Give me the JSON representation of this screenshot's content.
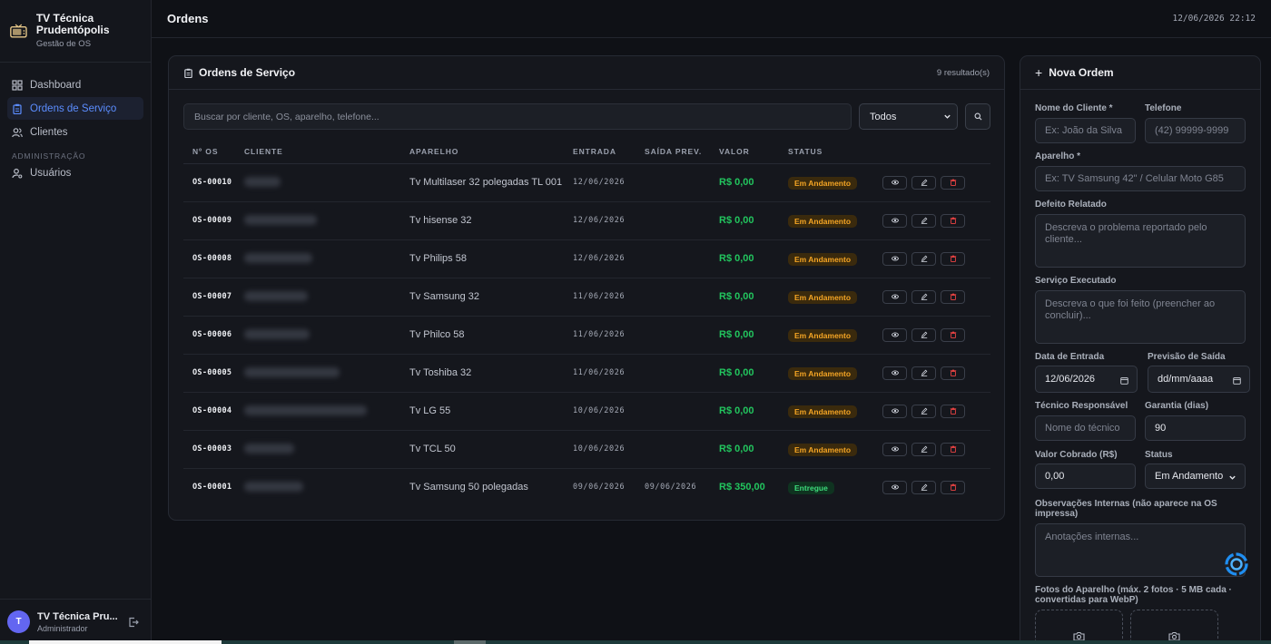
{
  "app": {
    "name": "TV Técnica Prudentópolis",
    "subtitle": "Gestão de OS"
  },
  "sidebar": {
    "items": [
      {
        "label": "Dashboard",
        "icon": "dashboard-icon",
        "active": false
      },
      {
        "label": "Ordens de Serviço",
        "icon": "clipboard-icon",
        "active": true
      },
      {
        "label": "Clientes",
        "icon": "users-icon",
        "active": false
      }
    ],
    "section_label": "ADMINISTRAÇÃO",
    "admin_items": [
      {
        "label": "Usuários",
        "icon": "user-cog-icon"
      }
    ]
  },
  "user": {
    "initial": "T",
    "name": "TV Técnica Pru...",
    "role": "Administrador"
  },
  "header": {
    "title": "Ordens",
    "datetime": "12/06/2026 22:12"
  },
  "orders_panel": {
    "title": "Ordens de Serviço",
    "result_count": "9 resultado(s)",
    "search_placeholder": "Buscar por cliente, OS, aparelho, telefone...",
    "filter_value": "Todos",
    "columns": [
      "Nº OS",
      "CLIENTE",
      "APARELHO",
      "ENTRADA",
      "SAÍDA PREV.",
      "VALOR",
      "STATUS"
    ],
    "rows": [
      {
        "os": "OS-00010",
        "device": "Tv Multilaser 32 polegadas TL 001",
        "in": "12/06/2026",
        "out": "",
        "value": "R$ 0,00",
        "status": "Em Andamento"
      },
      {
        "os": "OS-00009",
        "device": "Tv hisense 32",
        "in": "12/06/2026",
        "out": "",
        "value": "R$ 0,00",
        "status": "Em Andamento"
      },
      {
        "os": "OS-00008",
        "device": "Tv Philips 58",
        "in": "12/06/2026",
        "out": "",
        "value": "R$ 0,00",
        "status": "Em Andamento"
      },
      {
        "os": "OS-00007",
        "device": "Tv Samsung 32",
        "in": "11/06/2026",
        "out": "",
        "value": "R$ 0,00",
        "status": "Em Andamento"
      },
      {
        "os": "OS-00006",
        "device": "Tv Philco 58",
        "in": "11/06/2026",
        "out": "",
        "value": "R$ 0,00",
        "status": "Em Andamento"
      },
      {
        "os": "OS-00005",
        "device": "Tv Toshiba 32",
        "in": "11/06/2026",
        "out": "",
        "value": "R$ 0,00",
        "status": "Em Andamento"
      },
      {
        "os": "OS-00004",
        "device": "Tv LG 55",
        "in": "10/06/2026",
        "out": "",
        "value": "R$ 0,00",
        "status": "Em Andamento"
      },
      {
        "os": "OS-00003",
        "device": "Tv TCL 50",
        "in": "10/06/2026",
        "out": "",
        "value": "R$ 0,00",
        "status": "Em Andamento"
      },
      {
        "os": "OS-00001",
        "device": "Tv Samsung 50 polegadas",
        "in": "09/06/2026",
        "out": "09/06/2026",
        "value": "R$ 350,00",
        "status": "Entregue"
      }
    ]
  },
  "new_order": {
    "title": "Nova Ordem",
    "client_label": "Nome do Cliente *",
    "client_placeholder": "Ex: João da Silva",
    "phone_label": "Telefone",
    "phone_placeholder": "(42) 99999-9999",
    "device_label": "Aparelho *",
    "device_placeholder": "Ex: TV Samsung 42\" / Celular Moto G85",
    "defect_label": "Defeito Relatado",
    "defect_placeholder": "Descreva o problema reportado pelo cliente...",
    "service_label": "Serviço Executado",
    "service_placeholder": "Descreva o que foi feito (preencher ao concluir)...",
    "entry_label": "Data de Entrada",
    "entry_value": "12/06/2026",
    "exit_label": "Previsão de Saída",
    "exit_value": "dd/mm/aaaa",
    "tech_label": "Técnico Responsável",
    "tech_placeholder": "Nome do técnico",
    "warranty_label": "Garantia (dias)",
    "warranty_value": "90",
    "price_label": "Valor Cobrado (R$)",
    "price_value": "0,00",
    "status_label": "Status",
    "status_value": "Em Andamento",
    "notes_label": "Observações Internas (não aparece na OS impressa)",
    "notes_placeholder": "Anotações internas...",
    "photos_label": "Fotos do Aparelho (máx. 2 fotos · 5 MB cada · convertidas para WebP)"
  },
  "colors": {
    "accent": "#5b8dff",
    "success": "#22c55e",
    "warning": "#f5a524",
    "background": "#0f1116"
  }
}
